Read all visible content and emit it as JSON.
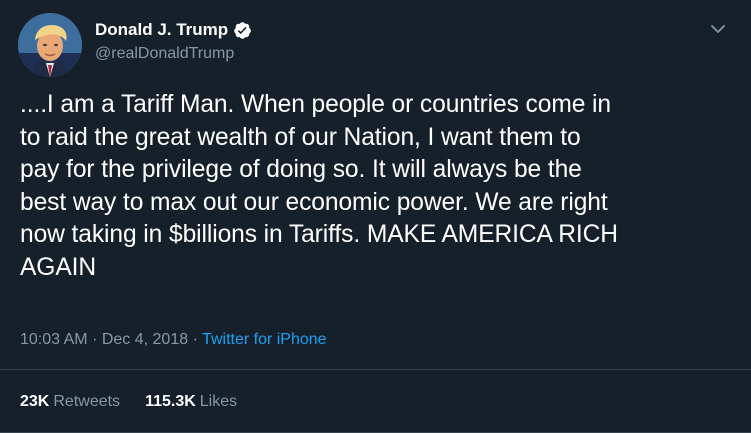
{
  "tweet": {
    "author": {
      "display_name": "Donald J. Trump",
      "handle": "@realDonaldTrump",
      "verified": true,
      "avatar_icon": "profile-photo"
    },
    "text": "....I am a Tariff Man. When people or countries come in\nto raid the great wealth of our Nation, I want them to\npay for the privilege of doing so. It will always be the\nbest way to max out our economic power. We are right\nnow taking in $billions in Tariffs. MAKE AMERICA RICH\nAGAIN",
    "time": "10:03 AM",
    "separator": "·",
    "date": "Dec 4, 2018",
    "source": "Twitter for iPhone",
    "stats": {
      "retweets_count": "23K",
      "retweets_label": "Retweets",
      "likes_count": "115.3K",
      "likes_label": "Likes"
    }
  },
  "colors": {
    "background": "#15202b",
    "text": "#ffffff",
    "secondary_text": "#8899a6",
    "accent": "#1da1f2",
    "divider": "#38444d"
  },
  "icons": {
    "verified": "verified-badge-icon",
    "menu": "chevron-down-icon"
  }
}
